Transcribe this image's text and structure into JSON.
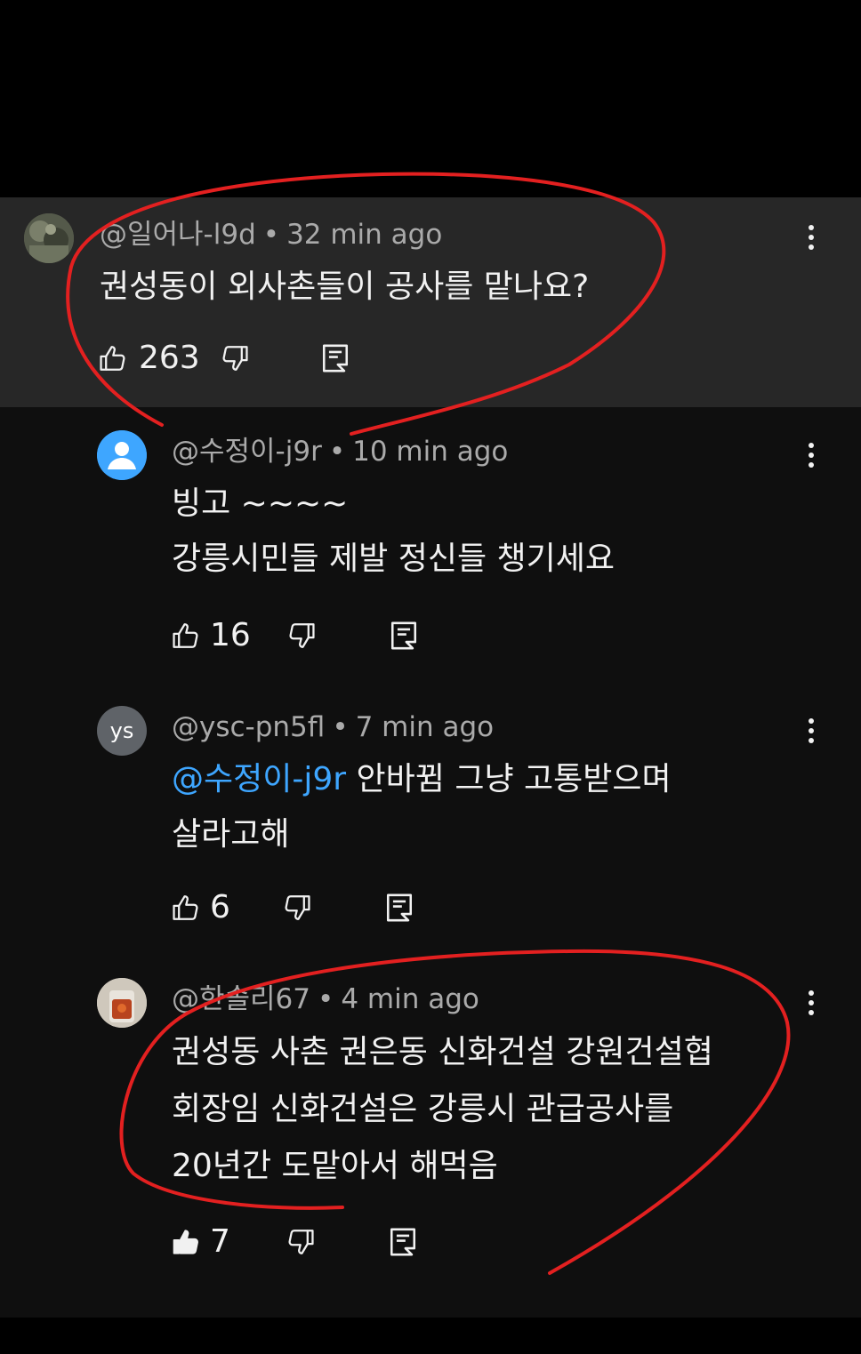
{
  "comments": [
    {
      "handle": "@일어나-l9d",
      "time": "32 min ago",
      "lines": [
        "권성동이 외사촌들이 공사를 맡나요?"
      ],
      "likes": "263",
      "avatar_icon": "photo-avatar-icon",
      "liked": false
    },
    {
      "handle": "@수정이-j9r",
      "time": "10 min ago",
      "lines": [
        "빙고  ~~~~",
        "강릉시민들 제발 정신들  챙기세요"
      ],
      "likes": "16",
      "avatar_icon": "default-user-avatar-icon",
      "liked": false
    },
    {
      "handle": "@ysc-pn5fl",
      "time": "7 min ago",
      "mention": "@수정이-j9r",
      "lines": [
        "안바뀜 그냥 고통받으며",
        "살라고해"
      ],
      "likes": "6",
      "avatar_text": "ys",
      "liked": false
    },
    {
      "handle": "@한솔리67",
      "time": "4 min ago",
      "lines": [
        "권성동 사촌 권은동 신화건설 강원건설협",
        "회장임 신화건설은 강릉시 관급공사를",
        "20년간 도맡아서 해먹음"
      ],
      "likes": "7",
      "avatar_icon": "photo-avatar-icon",
      "liked": true
    }
  ],
  "separator": "•",
  "colors": {
    "highlight_panel": "#272727",
    "background": "#0f0f0f",
    "mention": "#3ea6ff",
    "annotation": "#e32020",
    "default_avatar": "#3ea6ff"
  },
  "icons": [
    "thumbs-up-icon",
    "thumbs-down-icon",
    "reply-icon",
    "more-vert-icon"
  ]
}
